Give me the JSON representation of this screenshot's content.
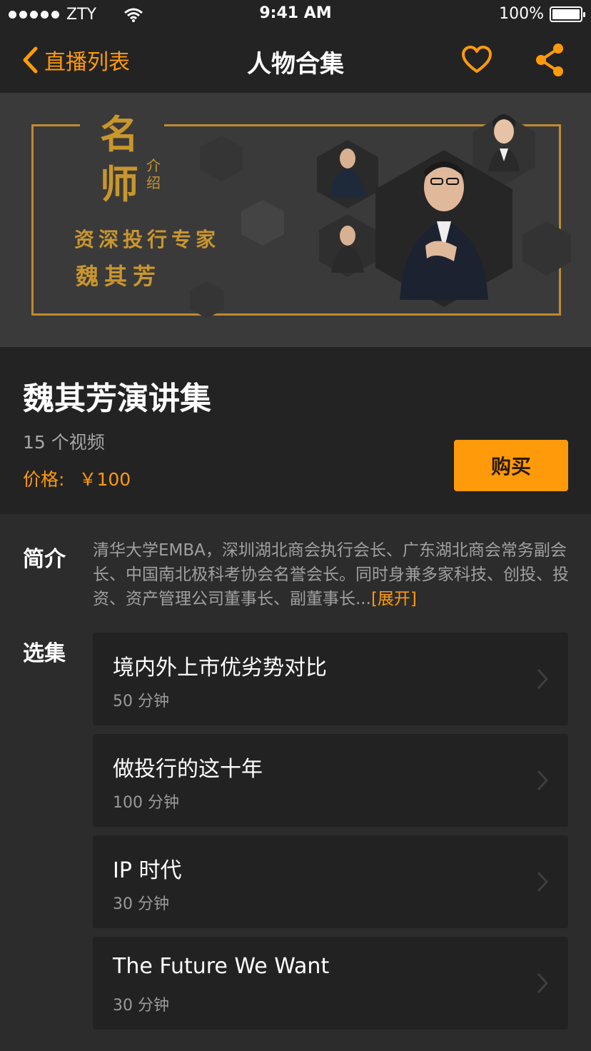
{
  "status_bar": {
    "carrier": "ZTY",
    "time": "9:41 AM",
    "battery": "100%",
    "battery_level": 1.0
  },
  "nav": {
    "back_label": "直播列表",
    "title": "人物合集",
    "favorite_icon": "heart-outline-icon",
    "share_icon": "share-icon",
    "accent_color": "#ff9a0a"
  },
  "banner": {
    "heading_char_1": "名",
    "heading_char_2": "师",
    "heading_small": "介绍",
    "subtitle": "资深投行专家",
    "name": "魏其芳"
  },
  "collection": {
    "title": "魏其芳演讲集",
    "video_count": "15 个视频",
    "price_label": "价格:",
    "price_value": "￥100",
    "buy_label": "购买"
  },
  "intro": {
    "label": "简介",
    "text": "清华大学EMBA，深圳湖北商会执行会长、广东湖北商会常务副会长、中国南北极科考协会名誉会长。同时身兼多家科技、创投、投资、资产管理公司董事长、副董事长...",
    "expand_label": "[展开]"
  },
  "episodes": {
    "label": "选集",
    "items": [
      {
        "title": "境内外上市优劣势对比",
        "duration": "50 分钟"
      },
      {
        "title": "做投行的这十年",
        "duration": "100 分钟"
      },
      {
        "title": "IP 时代",
        "duration": "30 分钟"
      },
      {
        "title": "The Future We Want",
        "duration": "30 分钟"
      }
    ]
  }
}
